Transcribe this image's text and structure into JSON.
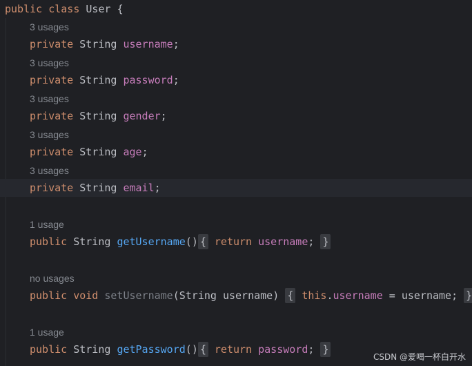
{
  "editor": {
    "class_decl": {
      "kw1": "public",
      "kw2": "class",
      "name": "User",
      "brace": "{"
    },
    "fields": [
      {
        "hint": "3 usages",
        "modifier": "private",
        "type": "String",
        "name": "username",
        "end": ";"
      },
      {
        "hint": "3 usages",
        "modifier": "private",
        "type": "String",
        "name": "password",
        "end": ";"
      },
      {
        "hint": "3 usages",
        "modifier": "private",
        "type": "String",
        "name": "gender",
        "end": ";"
      },
      {
        "hint": "3 usages",
        "modifier": "private",
        "type": "String",
        "name": "age",
        "end": ";"
      },
      {
        "hint": "3 usages",
        "modifier": "private",
        "type": "String",
        "name": "email",
        "end": ";"
      }
    ],
    "methods": [
      {
        "hint": "1 usage",
        "modifier": "public",
        "ret": "String",
        "name": "getUsername",
        "params_open": "(",
        "params_close": ")",
        "brace_open": "{",
        "body_kw": "return",
        "body_field": "username",
        "body_end": ";",
        "brace_close": "}"
      },
      {
        "hint": "no usages",
        "modifier": "public",
        "ret": "void",
        "name": "setUsername",
        "params": "(String username)",
        "brace_open": "{",
        "body_this": "this",
        "body_dot": ".",
        "body_field": "username",
        "body_rest": " = username;",
        "brace_close": "}"
      },
      {
        "hint": "1 usage",
        "modifier": "public",
        "ret": "String",
        "name": "getPassword",
        "params_open": "(",
        "params_close": ")",
        "brace_open": "{",
        "body_kw": "return",
        "body_field": "password",
        "body_end": ";",
        "brace_close": "}"
      }
    ]
  },
  "watermark": "CSDN @爱喝一杯白开水",
  "colors": {
    "background": "#1f2024",
    "current_line": "#26282e",
    "keyword": "#cf8e6d",
    "field": "#c77dbb",
    "method_declaration": "#56a8f5",
    "unused_method": "#7d8189",
    "text": "#bcbec4",
    "hint": "#868a91",
    "fold_background": "#393b40"
  }
}
